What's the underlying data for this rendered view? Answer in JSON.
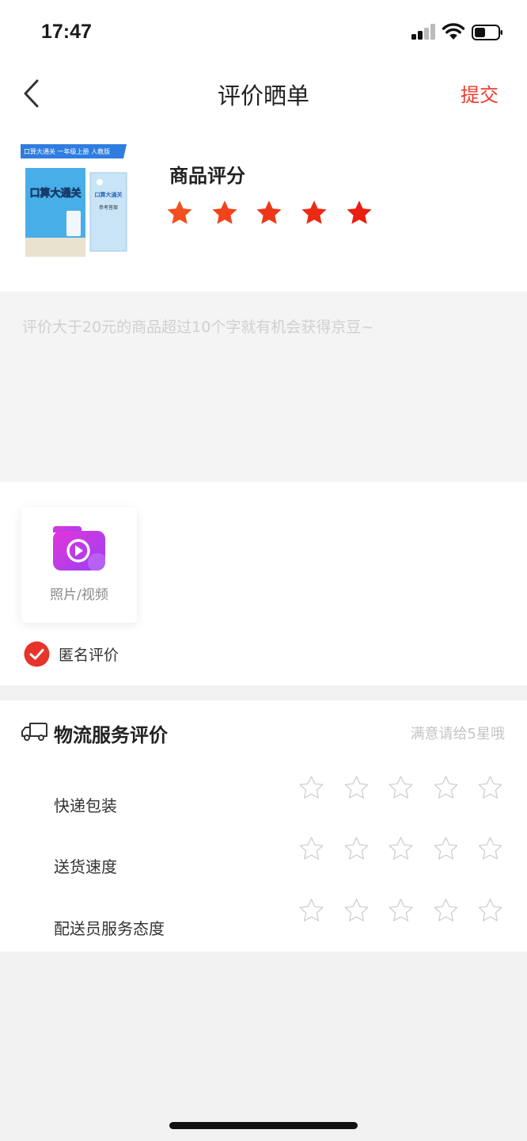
{
  "status_bar": {
    "time": "17:47"
  },
  "nav": {
    "title": "评价晒单",
    "submit_label": "提交"
  },
  "product": {
    "rating_label": "商品评分",
    "rating": 5,
    "rating_max": 5,
    "star_colors": [
      "#f2501f",
      "#f2431d",
      "#ef3618",
      "#ec2a14",
      "#e91e10"
    ],
    "cover_banner": "口算大通关  一年级上册  人教版",
    "book_title": "口算大通关",
    "answer_book_title": "参考答案"
  },
  "review": {
    "placeholder": "评价大于20元的商品超过10个字就有机会获得京豆~"
  },
  "media": {
    "upload_label": "照片/视频",
    "anonymous_label": "匿名评价",
    "anonymous_checked": true
  },
  "logistics": {
    "title": "物流服务评价",
    "hint": "满意请给5星哦",
    "items": [
      {
        "label": "快递包装",
        "rating": 0
      },
      {
        "label": "送货速度",
        "rating": 0
      },
      {
        "label": "配送员服务态度",
        "rating": 0
      }
    ]
  },
  "colors": {
    "accent": "#e93b2d",
    "page_bg": "#f2f2f2",
    "placeholder": "#d0d0d0",
    "hint": "#c4c4c4"
  },
  "icons": {
    "back": "chevron-left-icon",
    "camera": "camera-video-icon",
    "check": "check-circle-icon",
    "truck": "truck-icon",
    "star": "star-icon"
  }
}
